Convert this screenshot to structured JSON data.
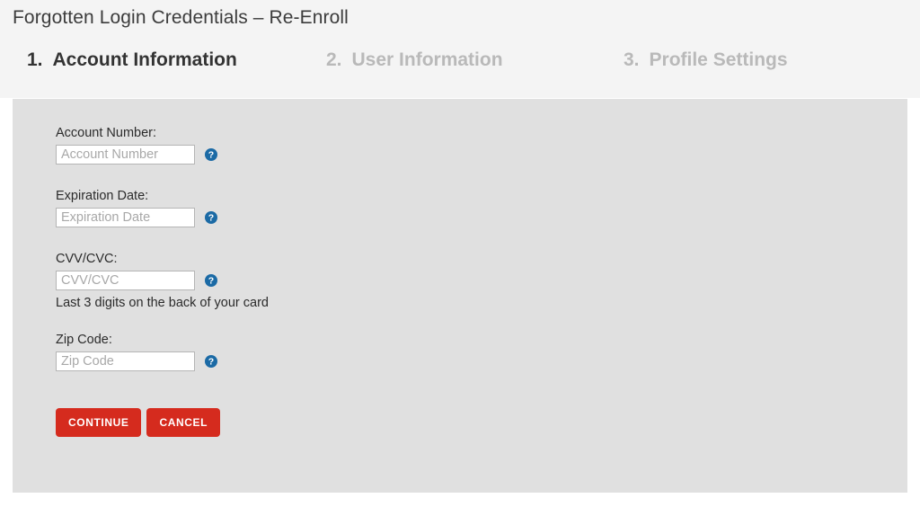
{
  "header": {
    "title": "Forgotten Login Credentials – Re-Enroll",
    "steps": [
      {
        "number": "1.",
        "label": "Account Information",
        "state": "active"
      },
      {
        "number": "2.",
        "label": "User Information",
        "state": "inactive"
      },
      {
        "number": "3.",
        "label": "Profile Settings",
        "state": "inactive"
      }
    ]
  },
  "form": {
    "fields": [
      {
        "label": "Account Number:",
        "placeholder": "Account Number",
        "value": "",
        "help_icon": "help-question-icon",
        "hint": ""
      },
      {
        "label": "Expiration Date:",
        "placeholder": "Expiration Date",
        "value": "",
        "help_icon": "help-question-icon",
        "hint": ""
      },
      {
        "label": "CVV/CVC:",
        "placeholder": "CVV/CVC",
        "value": "",
        "help_icon": "help-question-icon",
        "hint": "Last 3 digits on the back of your card"
      },
      {
        "label": "Zip Code:",
        "placeholder": "Zip Code",
        "value": "",
        "help_icon": "help-question-icon",
        "hint": ""
      }
    ],
    "buttons": {
      "continue_label": "CONTINUE",
      "cancel_label": "CANCEL"
    }
  },
  "colors": {
    "page_background": "#ffffff",
    "header_background": "#f4f4f4",
    "panel_background": "#e0e0e0",
    "button_red": "#d52b1e",
    "help_icon_blue": "#1b6aa5",
    "active_step_text": "#333333",
    "inactive_step_text": "#b9b9b9",
    "input_border": "#b5b5b5",
    "placeholder_text": "#a8a8a8"
  }
}
